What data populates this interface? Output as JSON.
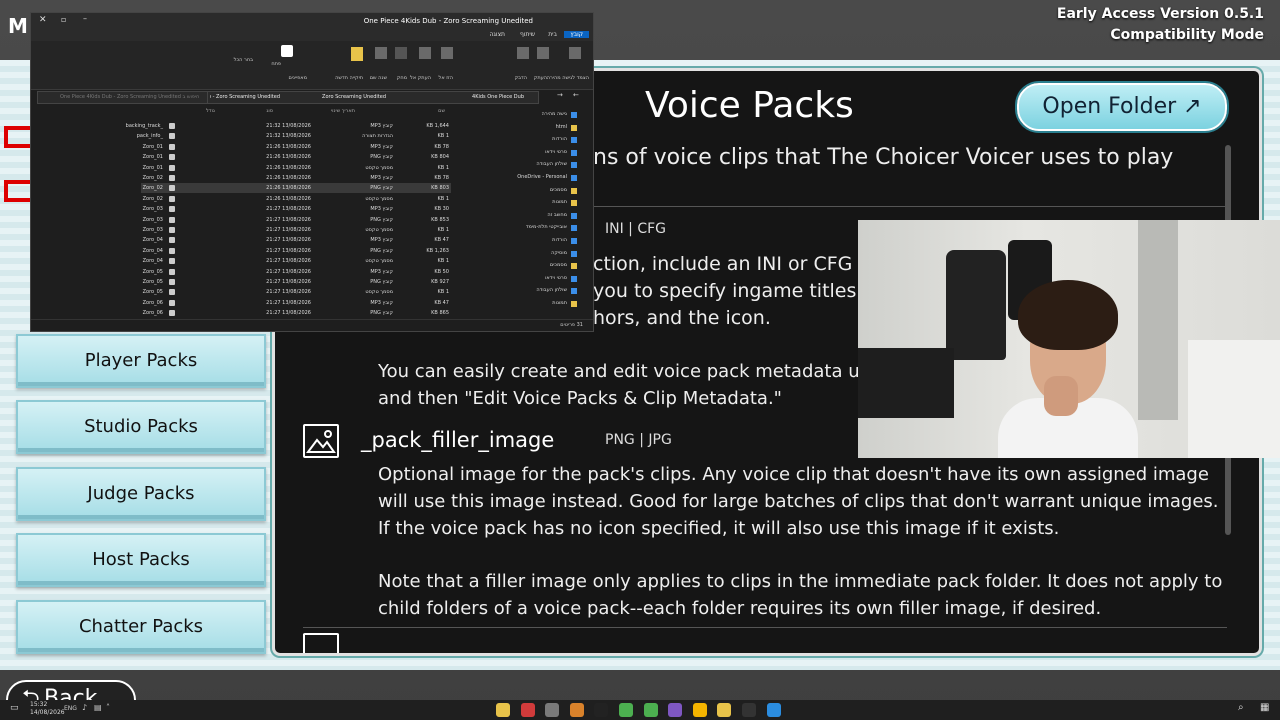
{
  "app": {
    "version_line1": "Early Access Version 0.5.1",
    "version_line2": "Compatibility Mode",
    "menu_title_partial": "M"
  },
  "panel": {
    "title": "Voice Packs",
    "open_folder_label": "Open Folder ↗",
    "intro_partial": "ns of voice clips that The Choicer Voicer uses to play",
    "ini_formats": "INI | CFG",
    "ini_line1": "ction, include an INI or CFG cor",
    "ini_line2": "you to specify ingame titles (i",
    "ini_line3": "hors, and the icon.",
    "ini_para2": "You can easily create and edit voice pack metadata u and then \"Edit Voice Packs & Clip Metadata.\"",
    "filler": {
      "name": "_pack_filler_image",
      "formats": "PNG | JPG",
      "para1": "Optional image for the pack's clips. Any voice clip that doesn't have its own assigned image will use this image instead. Good for large batches of clips that don't warrant unique images. If the voice pack has no icon specified, it will also use this image if it exists.",
      "para2": "Note that a filler image only applies to clips in the immediate pack folder. It does not apply to child folders of a voice pack--each folder requires its own filler image, if desired."
    }
  },
  "sidebar": {
    "items": [
      {
        "label": "Player Packs"
      },
      {
        "label": "Studio Packs"
      },
      {
        "label": "Judge Packs"
      },
      {
        "label": "Host Packs"
      },
      {
        "label": "Chatter Packs"
      }
    ]
  },
  "back_label": "Back",
  "explorer": {
    "title": "One Piece 4Kids Dub - Zoro Screaming Unedited",
    "tabs": [
      "קובץ",
      "בית",
      "שיתוף",
      "תצוגה"
    ],
    "search_placeholder": "One Piece 4Kids Dub - Zoro Screaming Unedited חיפוש ב",
    "breadcrumb": [
      "4Kids One Piece Dub",
      "Zoro Screaming Unedited",
      "One Piece 4Kids Dub - Zoro Screaming Unedited"
    ],
    "columns": {
      "name": "שם",
      "date": "תאריך שינוי",
      "type": "סוג",
      "size": "גודל"
    },
    "rows": [
      {
        "name": "_backing_track",
        "date": "13/08/2026 21:32",
        "type": "קובץ MP3",
        "size": "1,644 KB"
      },
      {
        "name": "_pack_info",
        "date": "13/08/2026 21:32",
        "type": "הגדרות תצורה",
        "size": "1 KB"
      },
      {
        "name": "01_Zoro",
        "date": "13/08/2026 21:26",
        "type": "קובץ MP3",
        "size": "78 KB"
      },
      {
        "name": "01_Zoro",
        "date": "13/08/2026 21:26",
        "type": "קובץ PNG",
        "size": "804 KB"
      },
      {
        "name": "01_Zoro",
        "date": "13/08/2026 21:26",
        "type": "מסמך טקסט",
        "size": "1 KB"
      },
      {
        "name": "02_Zoro",
        "date": "13/08/2026 21:26",
        "type": "קובץ MP3",
        "size": "78 KB"
      },
      {
        "name": "02_Zoro",
        "date": "13/08/2026 21:26",
        "type": "קובץ PNG",
        "size": "803 KB"
      },
      {
        "name": "02_Zoro",
        "date": "13/08/2026 21:26",
        "type": "מסמך טקסט",
        "size": "1 KB"
      },
      {
        "name": "03_Zoro",
        "date": "13/08/2026 21:27",
        "type": "קובץ MP3",
        "size": "30 KB"
      },
      {
        "name": "03_Zoro",
        "date": "13/08/2026 21:27",
        "type": "קובץ PNG",
        "size": "853 KB"
      },
      {
        "name": "03_Zoro",
        "date": "13/08/2026 21:27",
        "type": "מסמך טקסט",
        "size": "1 KB"
      },
      {
        "name": "04_Zoro",
        "date": "13/08/2026 21:27",
        "type": "קובץ MP3",
        "size": "47 KB"
      },
      {
        "name": "04_Zoro",
        "date": "13/08/2026 21:27",
        "type": "קובץ PNG",
        "size": "1,263 KB"
      },
      {
        "name": "04_Zoro",
        "date": "13/08/2026 21:27",
        "type": "מסמך טקסט",
        "size": "1 KB"
      },
      {
        "name": "05_Zoro",
        "date": "13/08/2026 21:27",
        "type": "קובץ MP3",
        "size": "50 KB"
      },
      {
        "name": "05_Zoro",
        "date": "13/08/2026 21:27",
        "type": "קובץ PNG",
        "size": "927 KB"
      },
      {
        "name": "05_Zoro",
        "date": "13/08/2026 21:27",
        "type": "מסמך טקסט",
        "size": "1 KB"
      },
      {
        "name": "06_Zoro",
        "date": "13/08/2026 21:27",
        "type": "קובץ MP3",
        "size": "47 KB"
      },
      {
        "name": "06_Zoro",
        "date": "13/08/2026 21:27",
        "type": "קובץ PNG",
        "size": "865 KB"
      }
    ],
    "nav": [
      {
        "label": "גישה מהירה",
        "color": "#3b8ee8"
      },
      {
        "label": "html",
        "color": "#e8c34a"
      },
      {
        "label": "הורדות",
        "color": "#3b8ee8"
      },
      {
        "label": "סרטי וידאו",
        "color": "#3b8ee8"
      },
      {
        "label": "שולחן העבודה",
        "color": "#3b8ee8"
      },
      {
        "label": "OneDrive - Personal",
        "color": "#3b8ee8"
      },
      {
        "label": "מסמכים",
        "color": "#e8c34a"
      },
      {
        "label": "תמונות",
        "color": "#e8c34a"
      },
      {
        "label": "מחשב זה",
        "color": "#3b8ee8"
      },
      {
        "label": "אובייקטי תלת-מימד",
        "color": "#3b8ee8"
      },
      {
        "label": "הורדות",
        "color": "#3b8ee8"
      },
      {
        "label": "מוסיקה",
        "color": "#3b8ee8"
      },
      {
        "label": "מסמכים",
        "color": "#e8c34a"
      },
      {
        "label": "סרטי וידאו",
        "color": "#3b8ee8"
      },
      {
        "label": "שולחן העבודה",
        "color": "#3b8ee8"
      },
      {
        "label": "תמונות",
        "color": "#e8c34a"
      }
    ],
    "status": "31 פריטים",
    "ribbon": [
      "הצמד לגישה מהירה",
      "העתק",
      "הדבק",
      "הזז אל",
      "העתק אל",
      "מחק",
      "שנה שם",
      "תיקייה חדשה",
      "מאפיינים",
      "פתח",
      "בחר הכל"
    ]
  },
  "taskbar": {
    "time": "15:32",
    "date": "14/08/2026",
    "lang": "ENG",
    "icons": [
      {
        "name": "file-explorer-icon",
        "color": "#e8c34a"
      },
      {
        "name": "game-icon",
        "color": "#d13b3b"
      },
      {
        "name": "app-icon-1",
        "color": "#7a7a7a"
      },
      {
        "name": "app-icon-2",
        "color": "#d9822b"
      },
      {
        "name": "terminal-icon",
        "color": "#222222"
      },
      {
        "name": "chrome-icon",
        "color": "#4caf50"
      },
      {
        "name": "app-icon-3",
        "color": "#4caf50"
      },
      {
        "name": "app-icon-4",
        "color": "#7e57c2"
      },
      {
        "name": "chrome-icon-2",
        "color": "#f4b400"
      },
      {
        "name": "folder-icon",
        "color": "#e8c34a"
      },
      {
        "name": "app-icon-5",
        "color": "#333333"
      },
      {
        "name": "edge-icon",
        "color": "#2b8de0"
      }
    ]
  }
}
